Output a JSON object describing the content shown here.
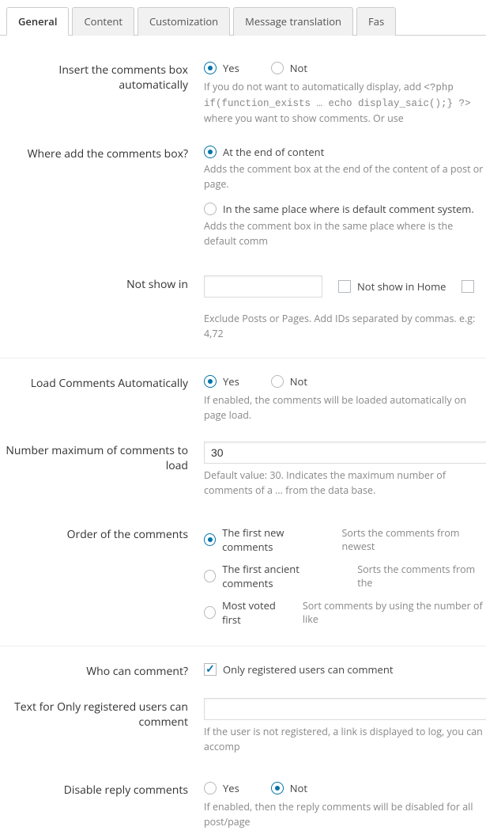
{
  "tabs": {
    "general": "General",
    "content": "Content",
    "customization": "Customization",
    "message_translation": "Message translation",
    "fas": "Fas"
  },
  "insert_box": {
    "label": "Insert the comments box automatically",
    "yes": "Yes",
    "no": "Not",
    "desc_pre": "If you do not want to automatically display, add ",
    "desc_code": "<?php if(function_exists … echo display_saic();} ?>",
    "desc_post": " where you want to show comments. Or use "
  },
  "where_add": {
    "label": "Where add the comments box?",
    "opt1": "At the end of content",
    "opt1_desc": "Adds the comment box at the end of the content of a post or page.",
    "opt2": "In the same place where is default comment system.",
    "opt2_desc": "Adds the comment box in the same place where is the default comm"
  },
  "not_show": {
    "label": "Not show in",
    "home_label": "Not show in Home",
    "desc": "Exclude Posts or Pages. Add IDs separated by commas. e.g: 4,72"
  },
  "load_auto": {
    "label": "Load Comments Automatically",
    "yes": "Yes",
    "no": "Not",
    "desc": "If enabled, the comments will be loaded automatically on page load."
  },
  "max_comments": {
    "label": "Number maximum of comments to load",
    "value": "30",
    "desc": "Default value: 30. Indicates the maximum number of comments of a … from the data base."
  },
  "order": {
    "label": "Order of the comments",
    "opt1": "The first new comments",
    "opt1_desc": "Sorts the comments from newest",
    "opt2": "The first ancient comments",
    "opt2_desc": "Sorts the comments from the",
    "opt3": "Most voted first",
    "opt3_desc": "Sort comments by using the number of like"
  },
  "who": {
    "label": "Who can comment?",
    "opt": "Only registered users can comment"
  },
  "text_registered": {
    "label": "Text for Only registered users can comment",
    "desc": "If the user is not registered, a link is displayed to log, you can accomp"
  },
  "disable_reply": {
    "label": "Disable reply comments",
    "yes": "Yes",
    "no": "Not",
    "desc": "If enabled, then the reply comments will be disabled for all post/page"
  }
}
